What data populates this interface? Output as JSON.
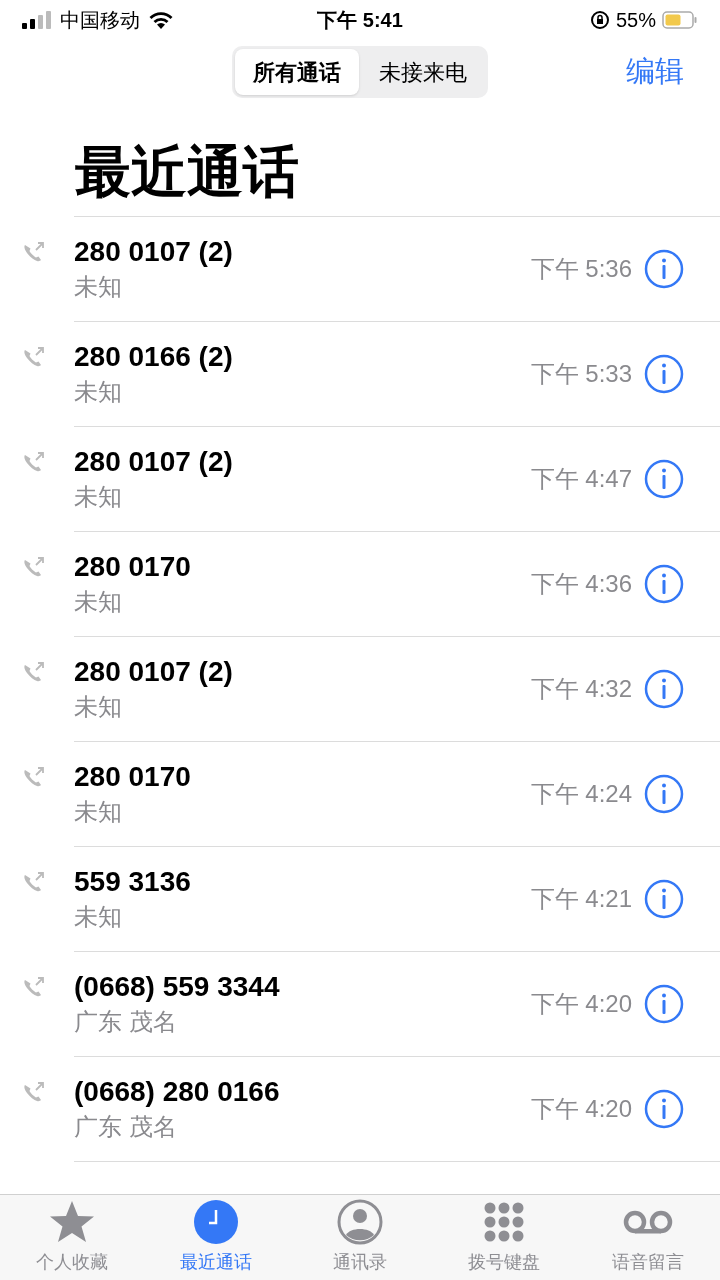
{
  "status_bar": {
    "carrier": "中国移动",
    "time": "下午 5:41",
    "battery": "55%"
  },
  "segments": [
    {
      "label": "所有通话",
      "selected": true
    },
    {
      "label": "未接来电",
      "selected": false
    }
  ],
  "edit_button": "编辑",
  "title": "最近通话",
  "calls": [
    {
      "number": "280 0107 (2)",
      "location": "未知",
      "time": "下午 5:36"
    },
    {
      "number": "280 0166 (2)",
      "location": "未知",
      "time": "下午 5:33"
    },
    {
      "number": "280 0107 (2)",
      "location": "未知",
      "time": "下午 4:47"
    },
    {
      "number": "280 0170",
      "location": "未知",
      "time": "下午 4:36"
    },
    {
      "number": "280 0107 (2)",
      "location": "未知",
      "time": "下午 4:32"
    },
    {
      "number": "280 0170",
      "location": "未知",
      "time": "下午 4:24"
    },
    {
      "number": "559 3136",
      "location": "未知",
      "time": "下午 4:21"
    },
    {
      "number": "(0668) 559 3344",
      "location": "广东 茂名",
      "time": "下午 4:20"
    },
    {
      "number": "(0668) 280 0166",
      "location": "广东 茂名",
      "time": "下午 4:20"
    }
  ],
  "tab_bar": [
    {
      "kind": "favorites",
      "label": "个人收藏",
      "selected": false
    },
    {
      "kind": "recents",
      "label": "最近通话",
      "selected": true
    },
    {
      "kind": "contacts",
      "label": "通讯录",
      "selected": false
    },
    {
      "kind": "keypad",
      "label": "拨号键盘",
      "selected": false
    },
    {
      "kind": "voicemail",
      "label": "语音留言",
      "selected": false
    }
  ]
}
